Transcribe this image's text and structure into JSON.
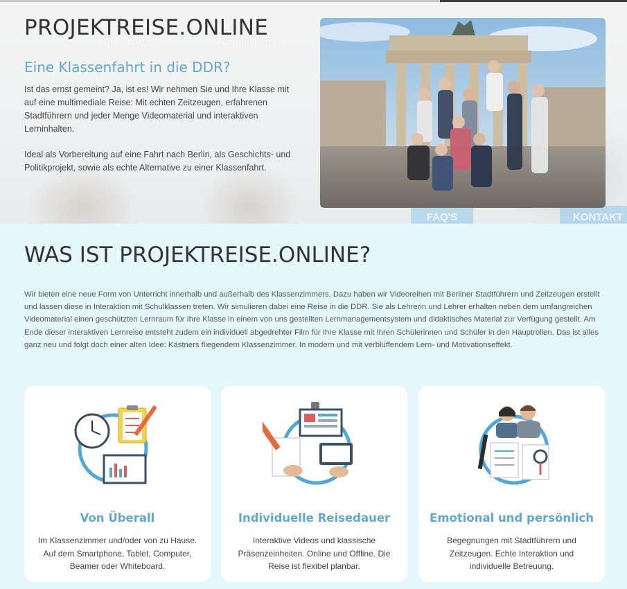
{
  "nav": {
    "items": [
      "Die Reisen",
      "Wie funktioniert's"
    ]
  },
  "hero": {
    "brand": "PROJEKTREISE.ONLINE",
    "subtitle": "Eine Klassenfahrt in die DDR?",
    "paragraph1": "Ist das ernst gemeint? Ja, ist es! Wir nehmen Sie und Ihre Klasse mit auf eine multimediale Reise: Mit echten Zeitzeugen, erfahrenen Stadtführern und jeder Menge Videomaterial und interaktiven Lerninhalten.",
    "paragraph2": "Ideal als Vorbereitung auf eine Fahrt nach Berlin, als Geschichts- und Politikprojekt, sowie als echte Alternative zu einer Klassenfahrt.",
    "buttons": [
      "FAQ'S",
      "KONTAKT"
    ]
  },
  "about": {
    "title": "WAS IST PROJEKTREISE.ONLINE?",
    "text": "Wir bieten eine neue Form von Unterricht innerhalb und außerhalb des Klassenzimmers. Dazu haben wir Videoreihen mit Berliner Stadtführern und Zeitzeugen erstellt und lassen diese in Interaktion mit Schulklassen treten. Wir simulieren dabei eine Reise in die DDR. Sie als Lehrerin und Lehrer erhalten neben dem umfangreichen Videomaterial einen geschützten Lernraum für Ihre Klasse in einem von uns gestellten Lernmanagementsystem und didaktisches Material zur Verfügung gestellt. Am Ende dieser interaktiven Lernreise entsteht zudem ein individuell abgedrehter Film für Ihre Klasse mit Ihren Schülerinnen und Schüler in den Hauptrollen. Das ist alles ganz neu und folgt doch einer alten Idee: Kästners fliegendem Klassenzimmer. In modern und mit verblüffendem Lern- und Motivationseffekt."
  },
  "cards": [
    {
      "icon": "clock-clipboard-laptop-icon",
      "title": "Von Überall",
      "text": "Im Klassenzimmer und/oder von zu Hause. Auf dem Smartphone, Tablet, Computer, Beamer oder Whiteboard."
    },
    {
      "icon": "devices-hands-icon",
      "title": "Individuelle Reisedauer",
      "text": "Interaktive Videos und klassische Präsenzeinheiten. Online und Offline. Die Reise ist flexibel planbar."
    },
    {
      "icon": "people-documents-icon",
      "title": "Emotional und persönlich",
      "text": "Begegnungen mit Stadtführern und Zeitzeugen. Echte Interaktion und individuelle Betreuung."
    }
  ],
  "colors": {
    "accent": "#5fa8d3",
    "section_bg": "#e4f7fc",
    "card_bg": "#ffffff"
  }
}
